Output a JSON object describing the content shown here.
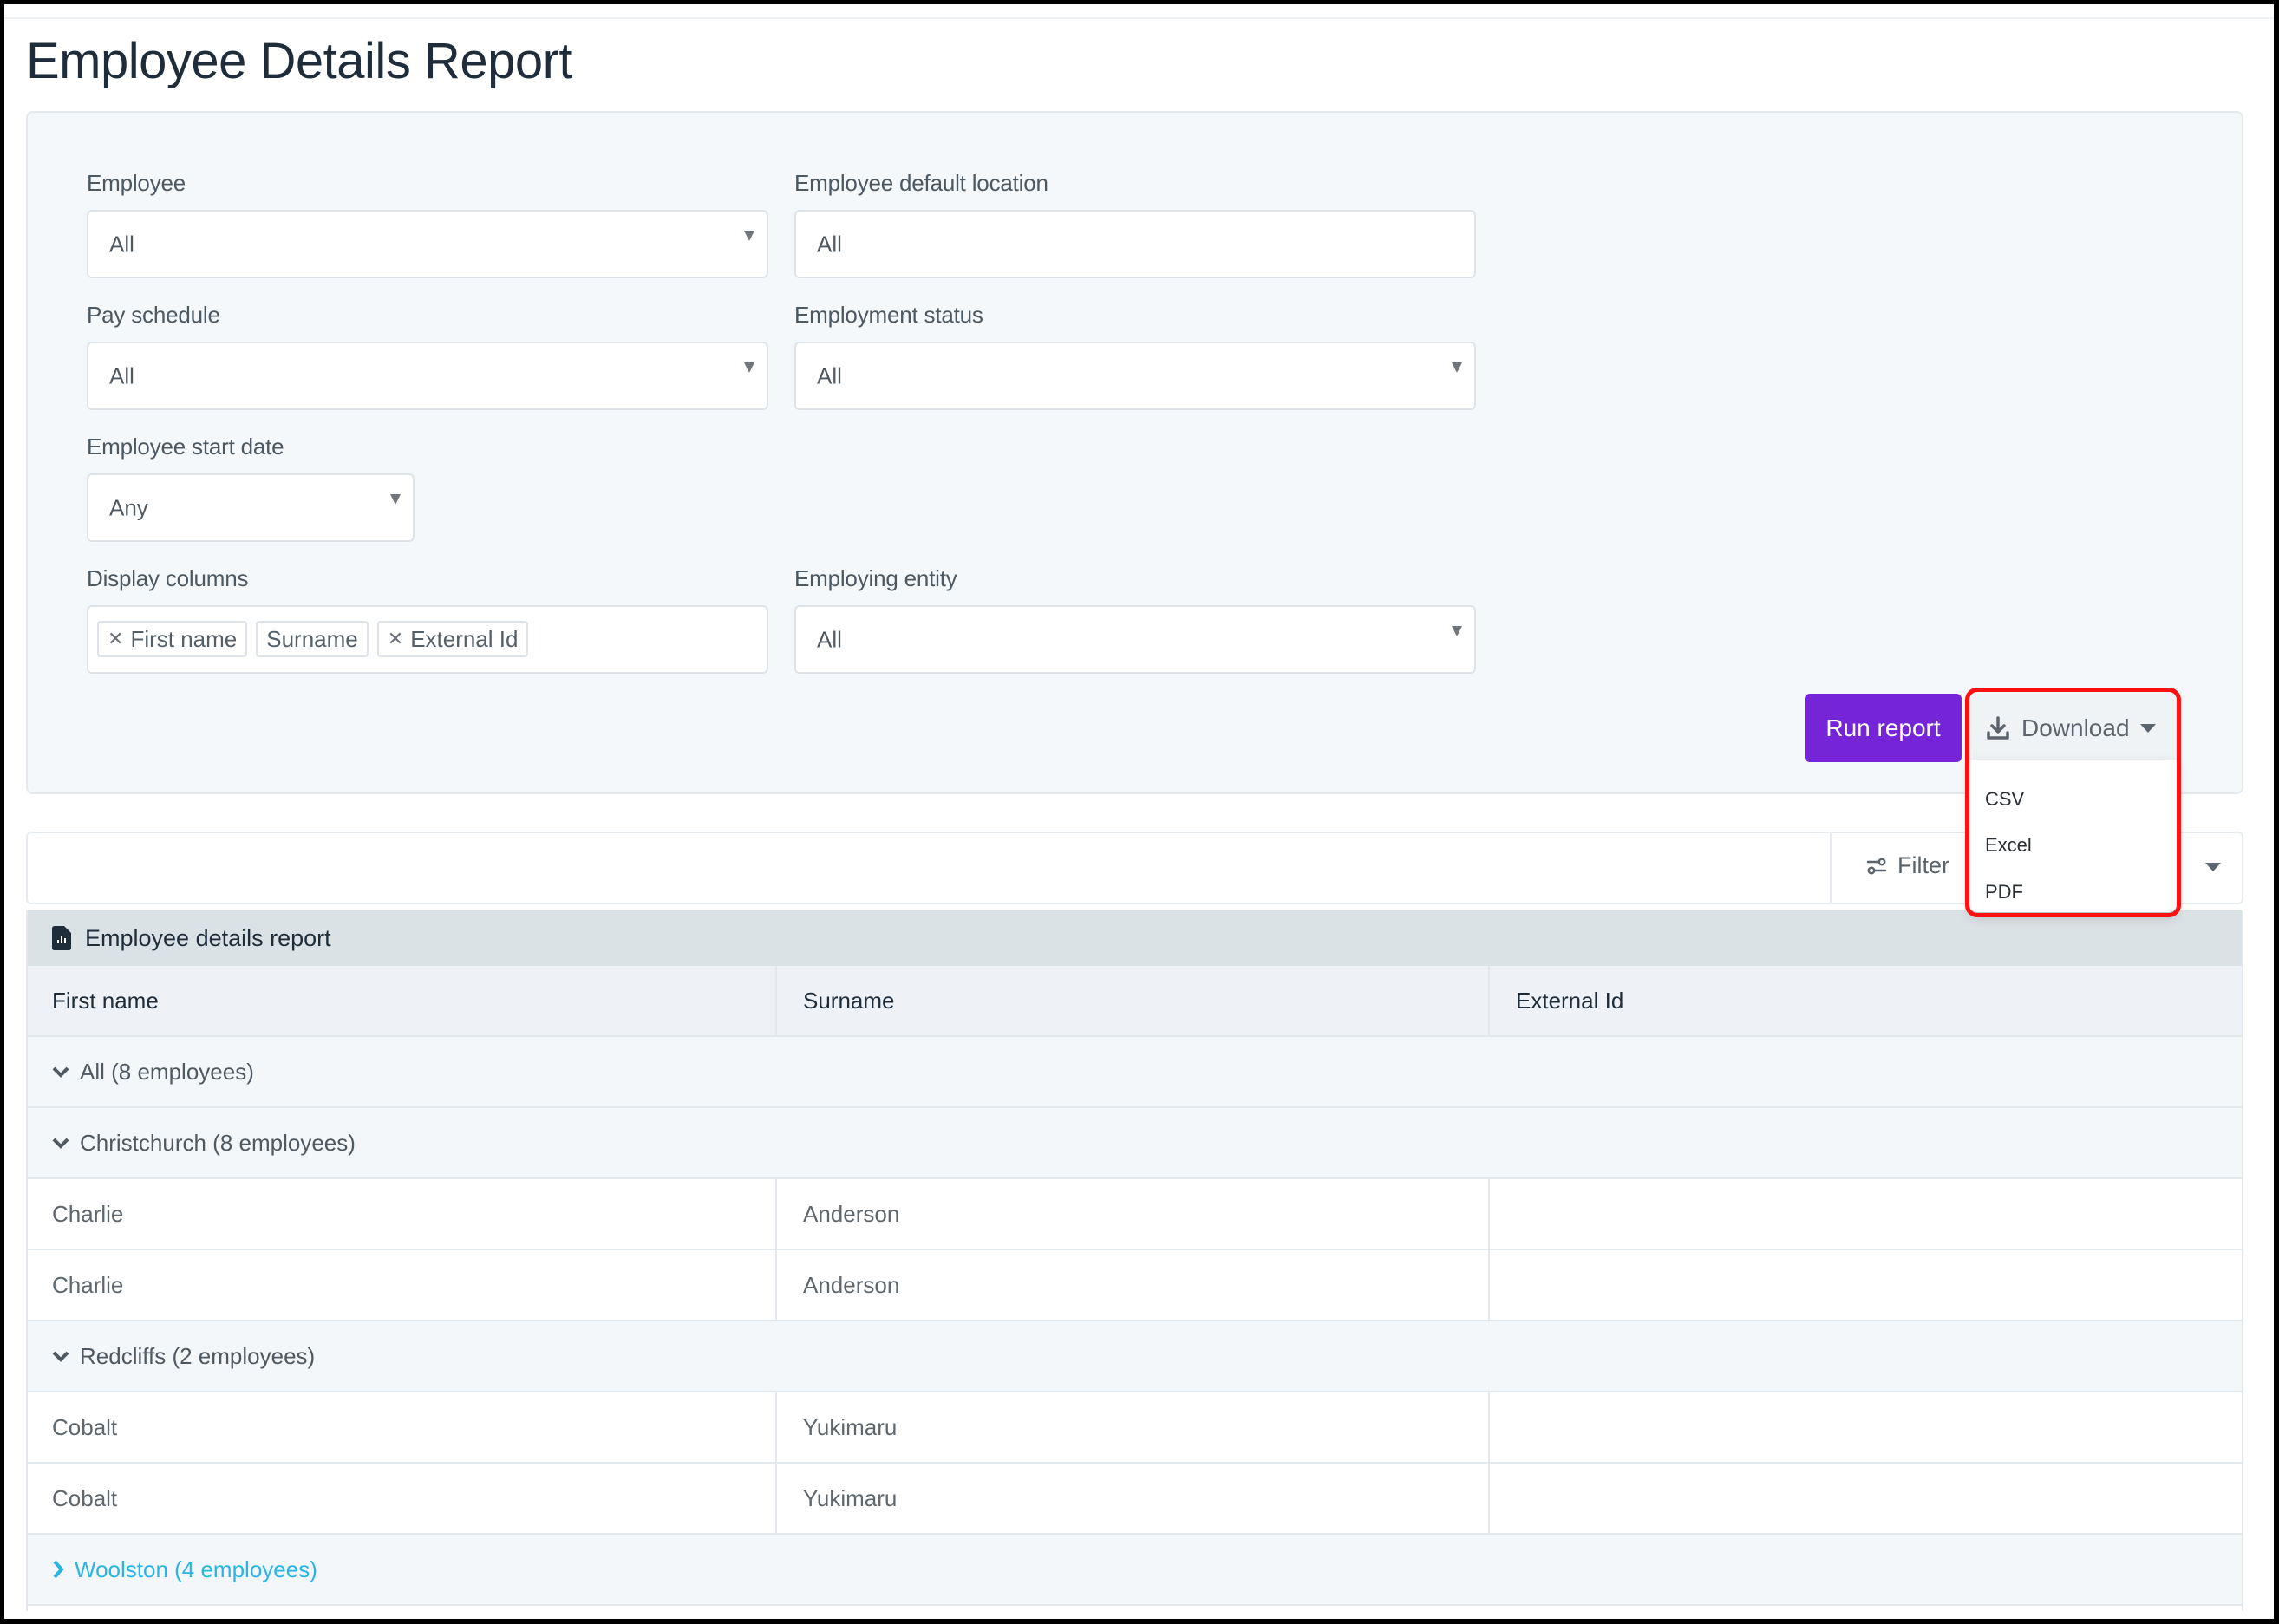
{
  "page": {
    "title": "Employee Details Report"
  },
  "filters": {
    "employee": {
      "label": "Employee",
      "value": "All"
    },
    "default_location": {
      "label": "Employee default location",
      "value": "All"
    },
    "pay_schedule": {
      "label": "Pay schedule",
      "value": "All"
    },
    "employment_status": {
      "label": "Employment status",
      "value": "All"
    },
    "start_date": {
      "label": "Employee start date",
      "value": "Any"
    },
    "display_columns": {
      "label": "Display columns",
      "tags": [
        {
          "label": "First name",
          "removable": true
        },
        {
          "label": "Surname",
          "removable": false
        },
        {
          "label": "External Id",
          "removable": true
        }
      ]
    },
    "employing_entity": {
      "label": "Employing entity",
      "value": "All"
    }
  },
  "actions": {
    "run_report": "Run report",
    "download": "Download",
    "download_options": [
      "CSV",
      "Excel",
      "PDF"
    ]
  },
  "toolbar": {
    "filter": "Filter"
  },
  "report": {
    "title": "Employee details report",
    "columns": [
      "First name",
      "Surname",
      "External Id"
    ],
    "rows": [
      {
        "type": "group",
        "label": "All (8 employees)",
        "expanded": true,
        "level": 0
      },
      {
        "type": "group",
        "label": "Christchurch (8 employees)",
        "expanded": true,
        "level": 0
      },
      {
        "type": "data",
        "cells": [
          "Charlie",
          "Anderson",
          ""
        ]
      },
      {
        "type": "data",
        "cells": [
          "Charlie",
          "Anderson",
          ""
        ]
      },
      {
        "type": "group",
        "label": "Redcliffs (2 employees)",
        "expanded": true,
        "level": 1
      },
      {
        "type": "data",
        "cells": [
          "Cobalt",
          "Yukimaru",
          ""
        ]
      },
      {
        "type": "data",
        "cells": [
          "Cobalt",
          "Yukimaru",
          ""
        ]
      },
      {
        "type": "group",
        "label": "Woolston (4 employees)",
        "expanded": false,
        "level": 1
      }
    ]
  },
  "colors": {
    "primary": "#7524d8",
    "link": "#2ab4e6",
    "highlight": "#ff1111"
  }
}
